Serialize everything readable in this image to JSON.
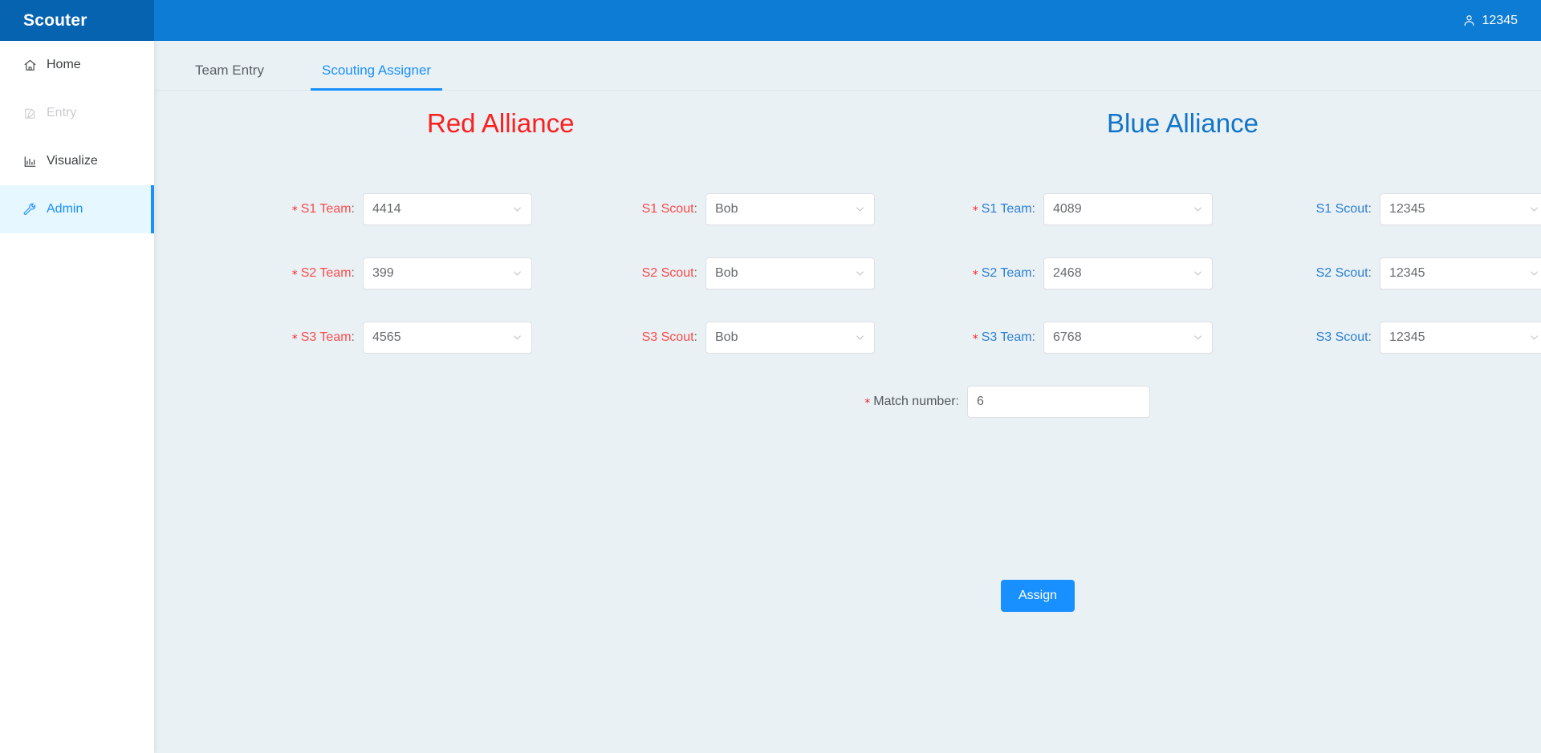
{
  "app": {
    "logo": "Scouter",
    "user": {
      "icon": "user-icon",
      "name": "12345"
    }
  },
  "sidebar": {
    "items": [
      {
        "icon": "home-icon",
        "label": "Home",
        "state": "normal"
      },
      {
        "icon": "edit-icon",
        "label": "Entry",
        "state": "disabled"
      },
      {
        "icon": "bar-chart-icon",
        "label": "Visualize",
        "state": "normal"
      },
      {
        "icon": "wrench-icon",
        "label": "Admin",
        "state": "active"
      }
    ]
  },
  "tabs": [
    {
      "label": "Team Entry",
      "active": false
    },
    {
      "label": "Scouting Assigner",
      "active": true
    }
  ],
  "alliances": {
    "red": {
      "title": "Red Alliance",
      "color": "#fa2020",
      "teams": [
        {
          "label": "S1 Team",
          "required": true,
          "value": "4414"
        },
        {
          "label": "S2 Team",
          "required": true,
          "value": "399"
        },
        {
          "label": "S3 Team",
          "required": true,
          "value": "4565"
        }
      ],
      "scouts": [
        {
          "label": "S1 Scout",
          "required": false,
          "value": "Bob"
        },
        {
          "label": "S2 Scout",
          "required": false,
          "value": "Bob"
        },
        {
          "label": "S3 Scout",
          "required": false,
          "value": "Bob"
        }
      ]
    },
    "blue": {
      "title": "Blue Alliance",
      "color": "#1275c9",
      "teams": [
        {
          "label": "S1 Team",
          "required": true,
          "value": "4089"
        },
        {
          "label": "S2 Team",
          "required": true,
          "value": "2468"
        },
        {
          "label": "S3 Team",
          "required": true,
          "value": "6768"
        }
      ],
      "scouts": [
        {
          "label": "S1 Scout",
          "required": false,
          "value": "12345"
        },
        {
          "label": "S2 Scout",
          "required": false,
          "value": "12345"
        },
        {
          "label": "S3 Scout",
          "required": false,
          "value": "12345"
        }
      ]
    }
  },
  "match": {
    "label": "Match number",
    "required": true,
    "value": "6"
  },
  "actions": {
    "assign_label": "Assign"
  },
  "colors": {
    "header_blue": "#0c7cd5",
    "logo_blue": "#0663b0",
    "accent_blue": "#1890ff",
    "red": "#fa2020",
    "page_bg": "#eaf1f5",
    "required_asterisk": "#f5222d"
  }
}
